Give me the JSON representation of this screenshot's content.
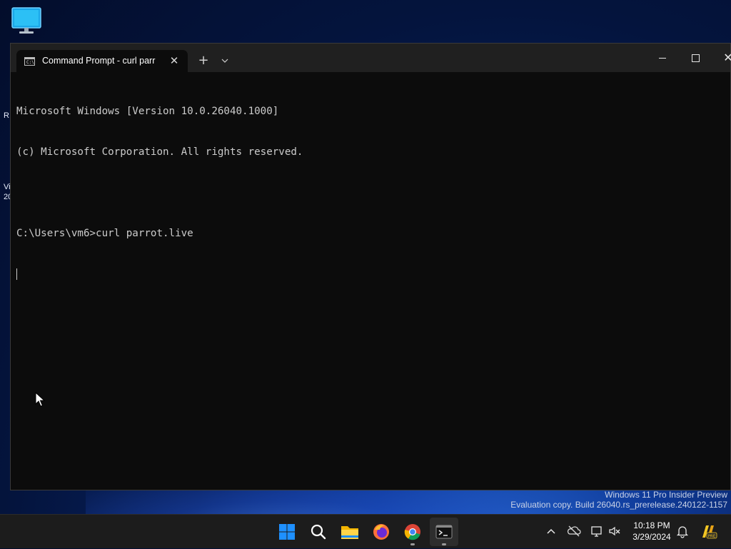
{
  "desktop": {
    "edge_text": [
      "R",
      "Vi",
      "20"
    ],
    "watermark": {
      "line1": "Windows 11 Pro Insider Preview",
      "line2": "Evaluation copy. Build 26040.rs_prerelease.240122-1157"
    }
  },
  "window": {
    "tab_title": "Command Prompt - curl  parr",
    "tab_icon_text": "C:\\",
    "new_tab_label": "+",
    "dropdown_label": "⌄",
    "close_tab_label": "✕",
    "close_window_label": "✕"
  },
  "console": {
    "lines": [
      "Microsoft Windows [Version 10.0.26040.1000]",
      "(c) Microsoft Corporation. All rights reserved.",
      "",
      "C:\\Users\\vm6>curl parrot.live"
    ]
  },
  "taskbar": {
    "pinned": [
      "start",
      "search",
      "file-explorer",
      "firefox",
      "chrome",
      "terminal"
    ],
    "tray": {
      "time": "10:18 PM",
      "date": "3/29/2024"
    }
  },
  "colors": {
    "console_bg": "#0c0c0c",
    "console_fg": "#cccccc",
    "titlebar_bg": "#202020",
    "taskbar_bg": "#1c1c1c",
    "start_blue": "#1e90ff"
  }
}
